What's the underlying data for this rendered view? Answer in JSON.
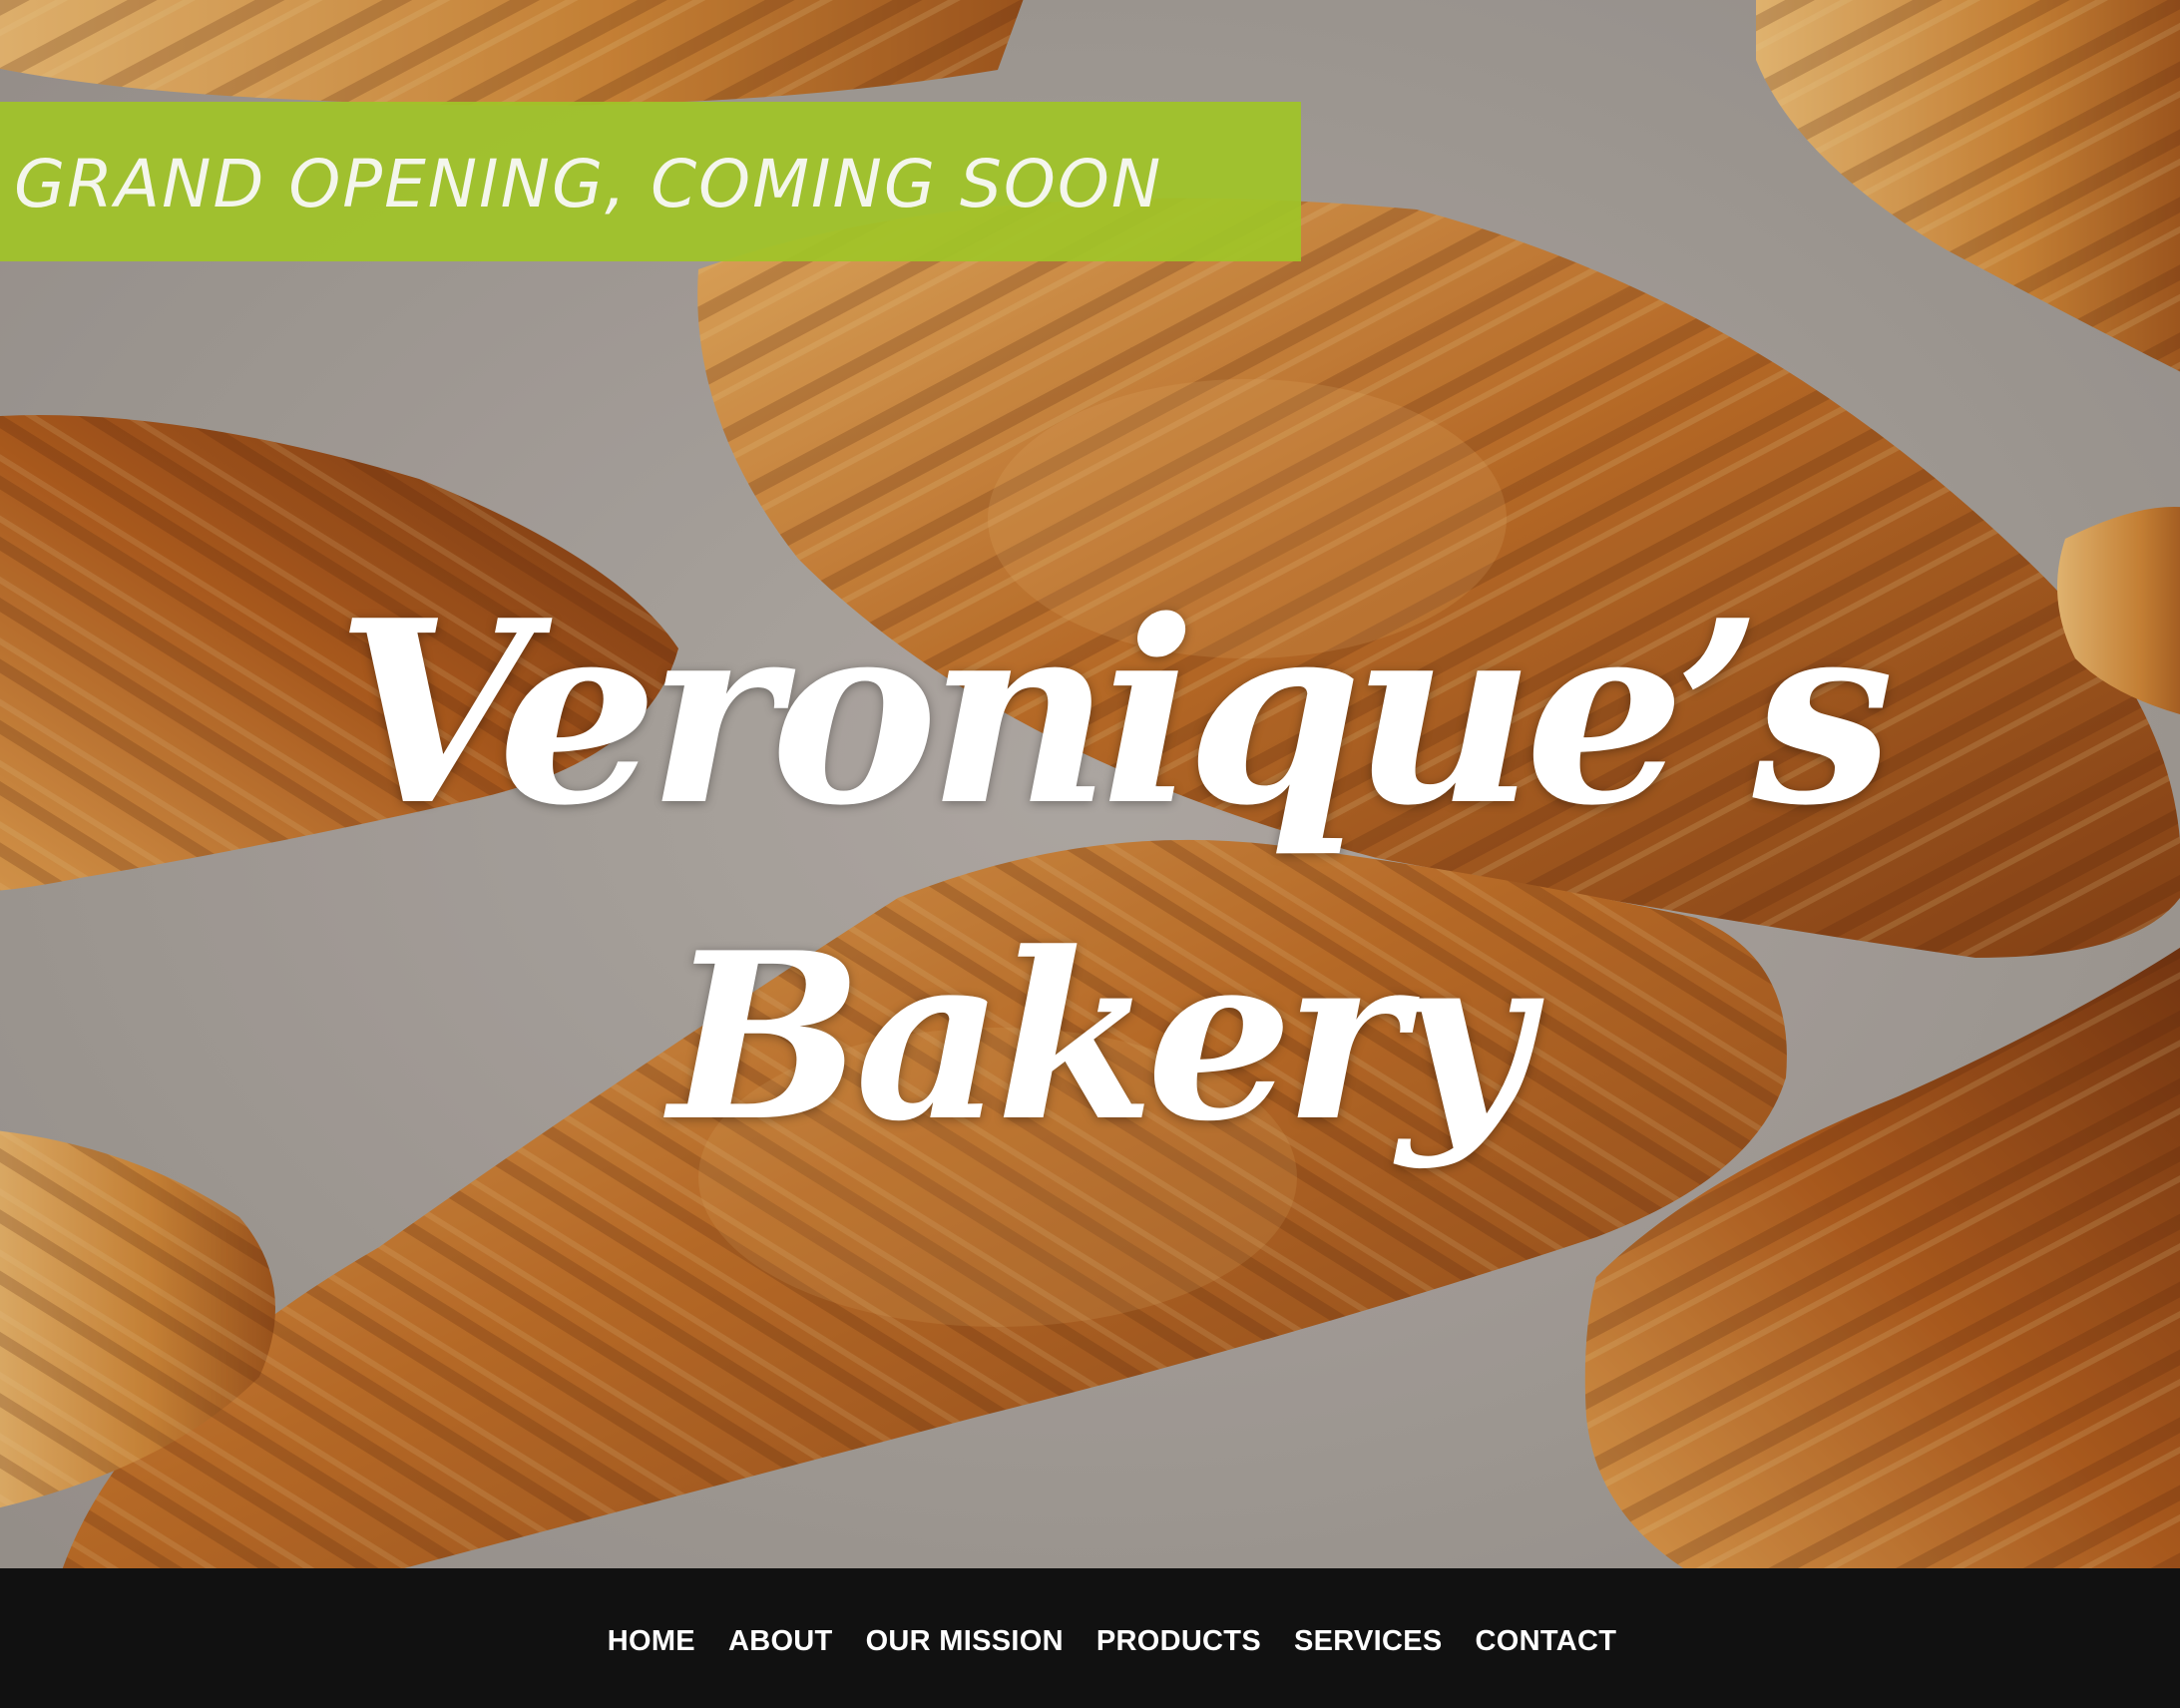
{
  "banner": {
    "text": "GRAND OPENING, COMING SOON",
    "color": "#a0c428"
  },
  "hero": {
    "title_line1": "Veronique’s",
    "title_line2": "Bakery",
    "image": "croissants-on-baking-paper"
  },
  "nav": {
    "items": [
      {
        "label": "HOME"
      },
      {
        "label": "ABOUT"
      },
      {
        "label": "OUR MISSION"
      },
      {
        "label": "PRODUCTS"
      },
      {
        "label": "SERVICES"
      },
      {
        "label": "CONTACT"
      }
    ],
    "background": "#111111"
  }
}
